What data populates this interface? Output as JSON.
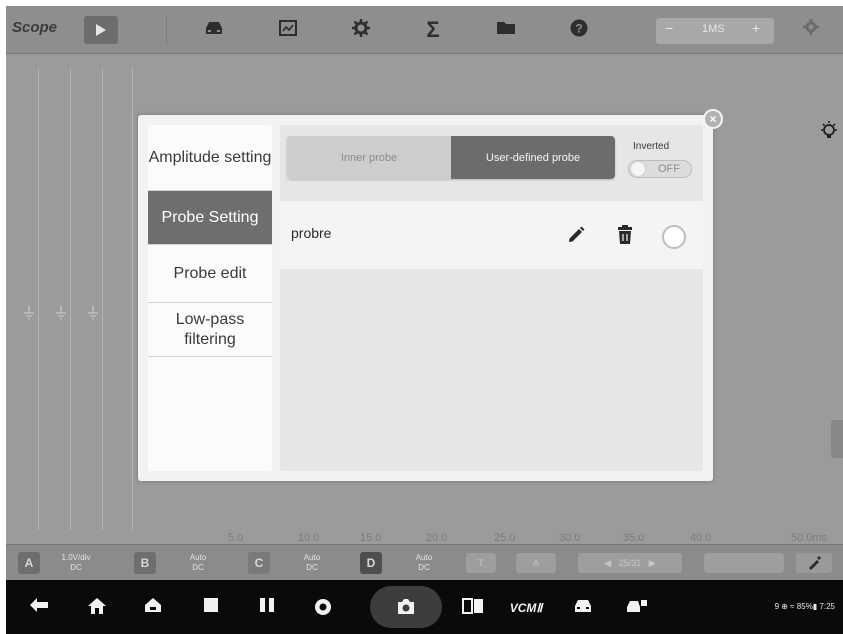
{
  "toolbar": {
    "app_name": "Scope",
    "time_base": "1MS",
    "time_minus": "−",
    "time_plus": "+",
    "icons": [
      "play-icon",
      "vehicle-icon",
      "save-icon",
      "settings-icon",
      "sum-icon",
      "folder-icon",
      "help-icon",
      "gear-icon"
    ]
  },
  "scope": {
    "x_axis_labels": [
      "5.0",
      "10.0",
      "15.0",
      "20.0",
      "25.0",
      "30.0",
      "35.0",
      "40.0",
      "50.0ms"
    ]
  },
  "channels": [
    {
      "id": "A",
      "scale": "1.0V/div",
      "coupling": "DC"
    },
    {
      "id": "B",
      "scale": "Auto",
      "coupling": "DC"
    },
    {
      "id": "C",
      "scale": "Auto",
      "coupling": "DC"
    },
    {
      "id": "D",
      "scale": "Auto",
      "coupling": "DC"
    }
  ],
  "chanbar": {
    "page": "25/31"
  },
  "dialog": {
    "menu": [
      {
        "label": "Amplitude setting",
        "active": false
      },
      {
        "label": "Probe Setting",
        "active": true
      },
      {
        "label": "Probe edit",
        "active": false
      },
      {
        "label": "Low-pass filtering",
        "active": false
      }
    ],
    "tabs": {
      "inner": "Inner probe",
      "user": "User-defined probe",
      "selected": "user"
    },
    "inverted": {
      "label": "Inverted",
      "state": "OFF"
    },
    "probes": [
      {
        "name": "probre",
        "selected": false
      }
    ]
  },
  "navbar": {
    "vcm_label": "VCMⅡ",
    "status": "9 ⊕ ≈ 85%▮ 7:25"
  },
  "colors": {
    "active_menu": "#6e6e6e",
    "selected_tab": "#6c6c6c",
    "navbar": "#0a0a0a"
  }
}
